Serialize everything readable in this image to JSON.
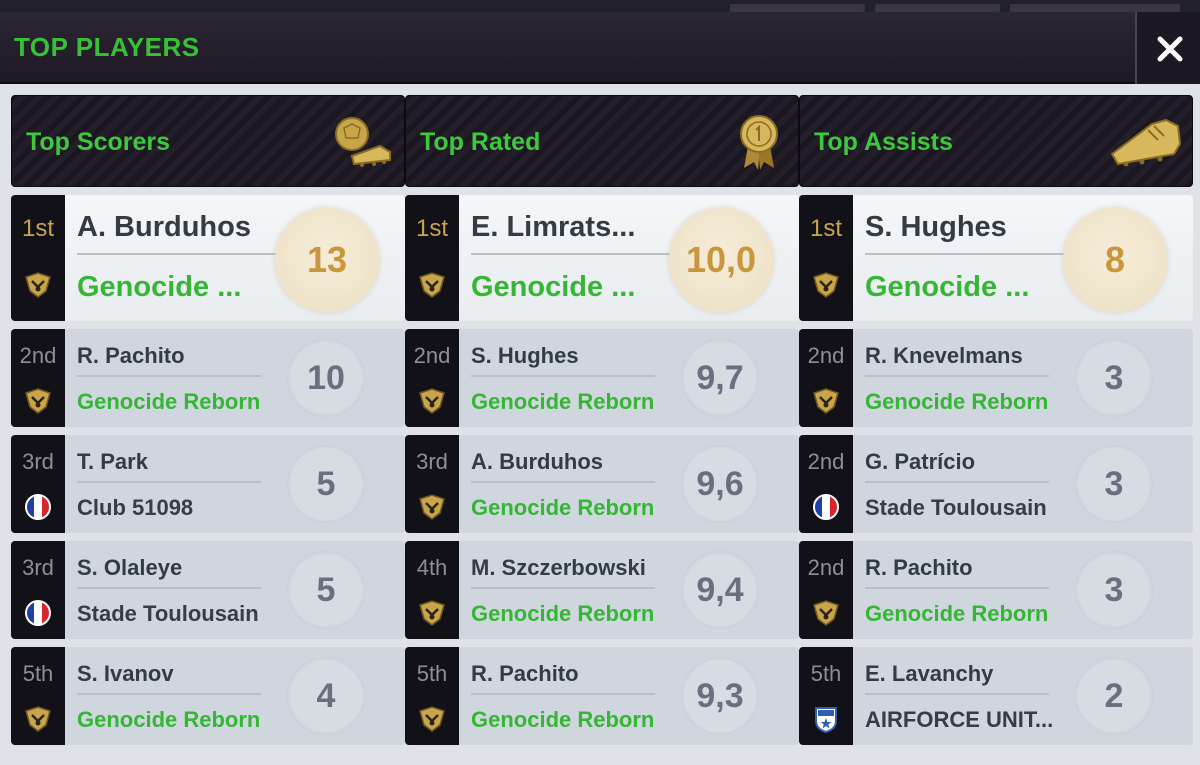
{
  "window": {
    "title": "TOP PLAYERS"
  },
  "colors": {
    "accent_green": "#35c235",
    "gold": "#c9963c"
  },
  "columns": [
    {
      "title": "Top Scorers",
      "icon": "ball-boot-icon",
      "entries": [
        {
          "rank": "1st",
          "name": "A. Burduhos",
          "club": "Genocide ...",
          "value": "13",
          "badge": "club-crest-icon"
        },
        {
          "rank": "2nd",
          "name": "R. Pachito",
          "club": "Genocide Reborn",
          "value": "10",
          "badge": "club-crest-icon"
        },
        {
          "rank": "3rd",
          "name": "T. Park",
          "club": "Club 51098",
          "value": "5",
          "badge": "france-flag-icon"
        },
        {
          "rank": "3rd",
          "name": "S. Olaleye",
          "club": "Stade Toulousain",
          "value": "5",
          "badge": "france-flag-icon"
        },
        {
          "rank": "5th",
          "name": "S. Ivanov",
          "club": "Genocide Reborn",
          "value": "4",
          "badge": "club-crest-icon"
        }
      ]
    },
    {
      "title": "Top Rated",
      "icon": "medal-icon",
      "entries": [
        {
          "rank": "1st",
          "name": "E. Limrats...",
          "club": "Genocide ...",
          "value": "10,0",
          "badge": "club-crest-icon"
        },
        {
          "rank": "2nd",
          "name": "S. Hughes",
          "club": "Genocide Reborn",
          "value": "9,7",
          "badge": "club-crest-icon"
        },
        {
          "rank": "3rd",
          "name": "A. Burduhos",
          "club": "Genocide Reborn",
          "value": "9,6",
          "badge": "club-crest-icon"
        },
        {
          "rank": "4th",
          "name": "M. Szczerbowski",
          "club": "Genocide Reborn",
          "value": "9,4",
          "badge": "club-crest-icon"
        },
        {
          "rank": "5th",
          "name": "R. Pachito",
          "club": "Genocide Reborn",
          "value": "9,3",
          "badge": "club-crest-icon"
        }
      ]
    },
    {
      "title": "Top Assists",
      "icon": "boot-icon",
      "entries": [
        {
          "rank": "1st",
          "name": "S. Hughes",
          "club": "Genocide ...",
          "value": "8",
          "badge": "club-crest-icon"
        },
        {
          "rank": "2nd",
          "name": "R. Knevelmans",
          "club": "Genocide Reborn",
          "value": "3",
          "badge": "club-crest-icon"
        },
        {
          "rank": "2nd",
          "name": "G. Patrício",
          "club": "Stade Toulousain",
          "value": "3",
          "badge": "france-flag-icon"
        },
        {
          "rank": "2nd",
          "name": "R. Pachito",
          "club": "Genocide Reborn",
          "value": "3",
          "badge": "club-crest-icon"
        },
        {
          "rank": "5th",
          "name": "E. Lavanchy",
          "club": "AIRFORCE UNIT...",
          "value": "2",
          "badge": "star-shield-icon"
        }
      ]
    }
  ]
}
